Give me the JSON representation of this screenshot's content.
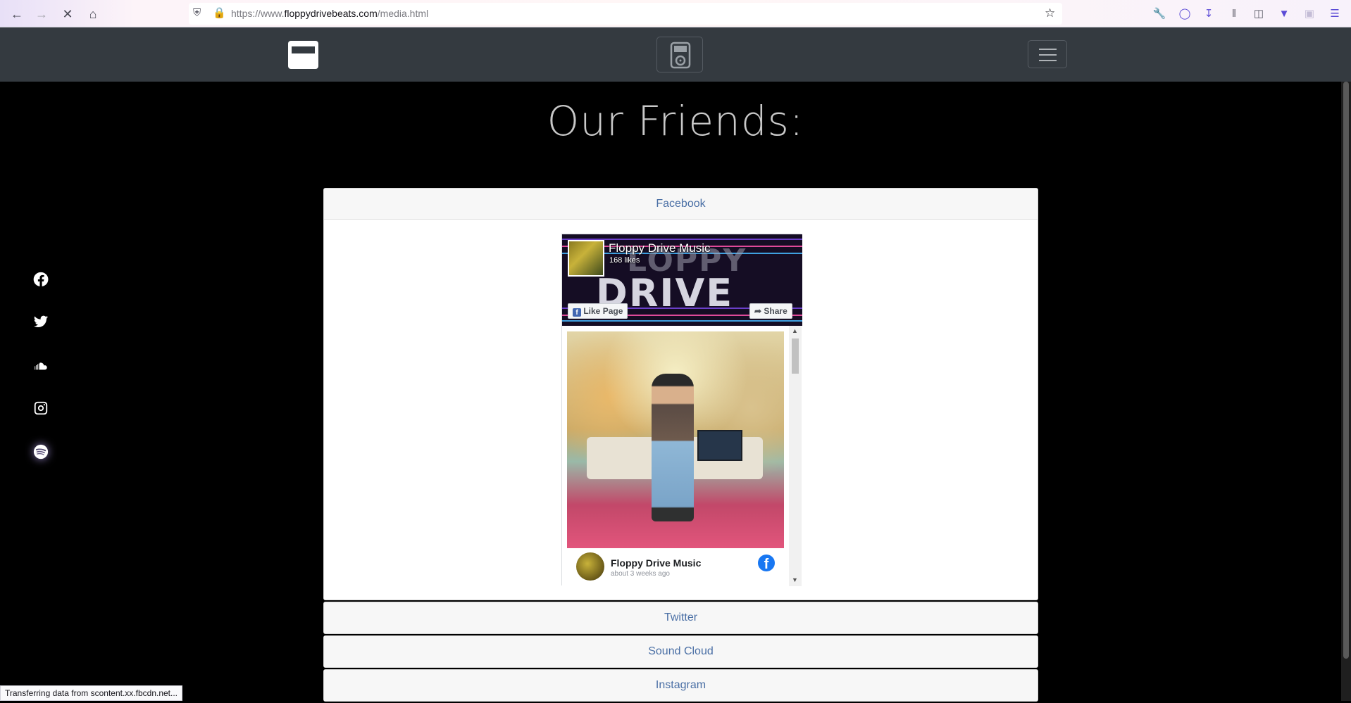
{
  "browser": {
    "url_prefix": "https://www.",
    "url_domain": "floppydrivebeats.com",
    "url_path": "/media.html",
    "status": "Transferring data from scontent.xx.fbcdn.net..."
  },
  "page": {
    "title": "Our Friends:"
  },
  "social_icons": [
    "facebook-icon",
    "twitter-icon",
    "soundcloud-icon",
    "instagram-icon",
    "spotify-icon"
  ],
  "accordion": {
    "facebook": "Facebook",
    "twitter": "Twitter",
    "soundcloud": "Sound Cloud",
    "instagram": "Instagram"
  },
  "fb_widget": {
    "page_name": "Floppy Drive Music",
    "likes": "168 likes",
    "like_button": "Like Page",
    "share_button": "Share",
    "cover_word_1": "LOPPY",
    "cover_word_2": "DRIVE",
    "post_author": "Floppy Drive Music",
    "post_time": "about 3 weeks ago"
  },
  "colors": {
    "navbar": "#343a40",
    "accordion_link": "#4a6fa5",
    "facebook_blue": "#1877f2"
  }
}
